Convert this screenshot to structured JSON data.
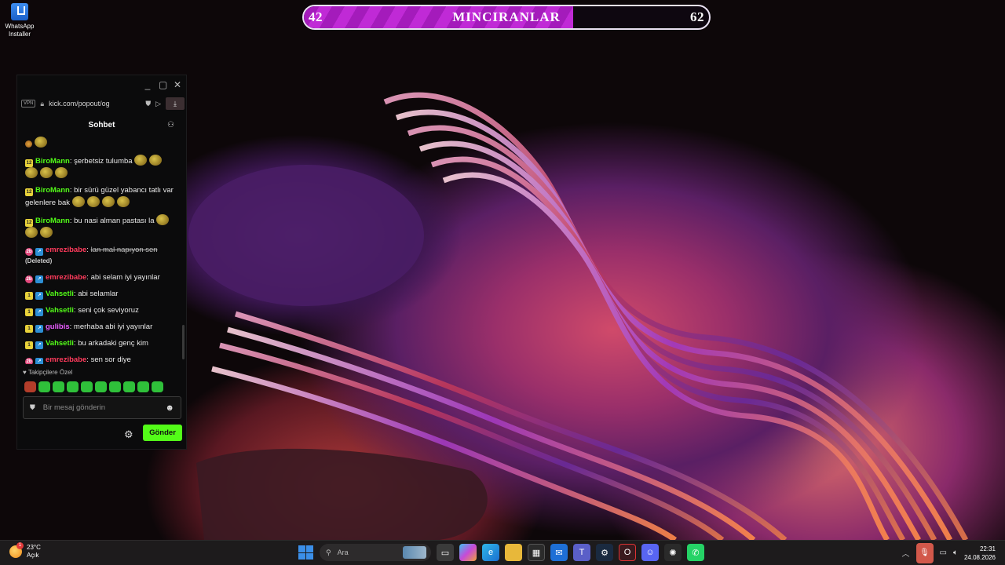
{
  "desktop": {
    "icon_label": "WhatsApp Installer"
  },
  "goal_bar": {
    "left_value": "42",
    "title": "MINCIRANLAR",
    "right_value": "62",
    "progress": 0.665,
    "color": "#c02ad6"
  },
  "chat_window": {
    "vpn_label": "VPN",
    "url": "kick.com/popout/og",
    "title": "Sohbet",
    "messages": [
      {
        "badge": "12",
        "user": "BiroMann",
        "user_color": "#53fc18",
        "text": "şerbetsiz tulumba"
      },
      {
        "badge": "12",
        "user": "BiroMann",
        "user_color": "#53fc18",
        "text": "bir sürü güzel yabancı tatlı var gelenlere bak"
      },
      {
        "badge": "12",
        "user": "BiroMann",
        "user_color": "#53fc18",
        "text": "bu nasi alman pastası la"
      },
      {
        "badge": "2b",
        "user": "emrezibabe",
        "user_color": "#ff3b5c",
        "text": "lan mal napıyon sen",
        "deleted_tag": "(Deleted)"
      },
      {
        "badge": "2b",
        "user": "emrezibabe",
        "user_color": "#ff3b5c",
        "text": "abi selam iyi yayınlar"
      },
      {
        "badge": "1",
        "user": "Vahsetli",
        "user_color": "#53fc18",
        "text": "abi selamlar"
      },
      {
        "badge": "1",
        "user": "Vahsetli",
        "user_color": "#53fc18",
        "text": "seni çok seviyoruz"
      },
      {
        "badge": "1",
        "user": "gulibis",
        "user_color": "#e85cff",
        "text": "merhaba abi iyi yayınlar"
      },
      {
        "badge": "1",
        "user": "Vahsetli",
        "user_color": "#53fc18",
        "text": "bu arkadaki genç kim"
      },
      {
        "badge": "2b",
        "user": "emrezibabe",
        "user_color": "#ff3b5c",
        "text": "sen sor diye"
      }
    ],
    "favorites_label": "Takipçilere Özel",
    "input_placeholder": "Bir mesaj gönderin",
    "send_label": "Gönder",
    "send_color": "#53fc18"
  },
  "taskbar": {
    "weather_temp": "23°C",
    "weather_desc": "Açık",
    "search_placeholder": "Ara",
    "time": "22:31",
    "date": "24.08.2026",
    "apps": [
      "file-icon",
      "copilot-icon",
      "edge-icon",
      "folder-icon",
      "store-icon",
      "mail-icon",
      "teams-icon",
      "steam-icon",
      "opera-icon",
      "discord-icon",
      "chatgpt-icon",
      "whatsapp-icon"
    ]
  }
}
